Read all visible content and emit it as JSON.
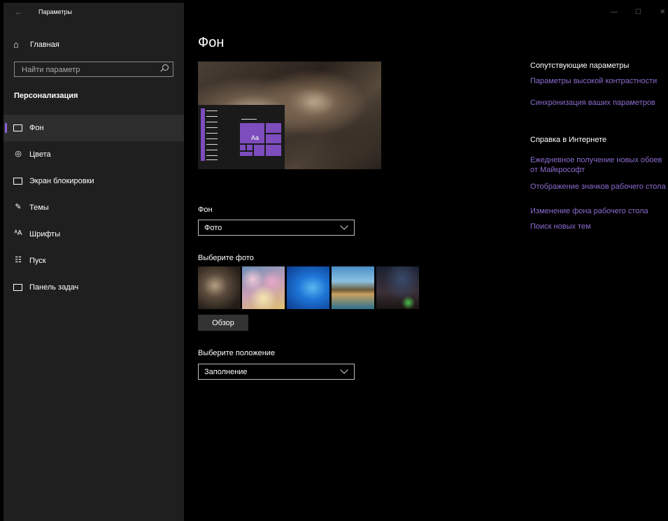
{
  "app": {
    "title": "Параметры",
    "back_glyph": "←"
  },
  "window_controls": {
    "minimize": "—",
    "maximize": "☐",
    "close": "✕"
  },
  "sidebar": {
    "home_label": "Главная",
    "search_placeholder": "Найти параметр",
    "section_title": "Персонализация",
    "items": [
      {
        "label": "Фон",
        "icon": "image-icon",
        "active": true
      },
      {
        "label": "Цвета",
        "icon": "palette-icon",
        "active": false
      },
      {
        "label": "Экран блокировки",
        "icon": "lock-screen-icon",
        "active": false
      },
      {
        "label": "Темы",
        "icon": "themes-icon",
        "active": false
      },
      {
        "label": "Шрифты",
        "icon": "fonts-icon",
        "active": false
      },
      {
        "label": "Пуск",
        "icon": "start-icon",
        "active": false
      },
      {
        "label": "Панель задач",
        "icon": "taskbar-icon",
        "active": false
      }
    ]
  },
  "main": {
    "title": "Фон",
    "preview_sample_text": "Aa",
    "background_label": "Фон",
    "background_value": "Фото",
    "choose_photo_label": "Выберите фото",
    "browse_label": "Обзор",
    "position_label": "Выберите положение",
    "position_value": "Заполнение",
    "accent_color": "#7d4cbd"
  },
  "related": {
    "heading": "Сопутствующие параметры",
    "links": [
      "Параметры высокой контрастности",
      "Синхронизация ваших параметров"
    ]
  },
  "help": {
    "heading": "Справка в Интернете",
    "links": [
      "Ежедневное получение новых обоев от Майкрософт",
      "Отображение значков рабочего стола",
      "Изменение фона рабочего стола",
      "Поиск новых тем"
    ]
  }
}
